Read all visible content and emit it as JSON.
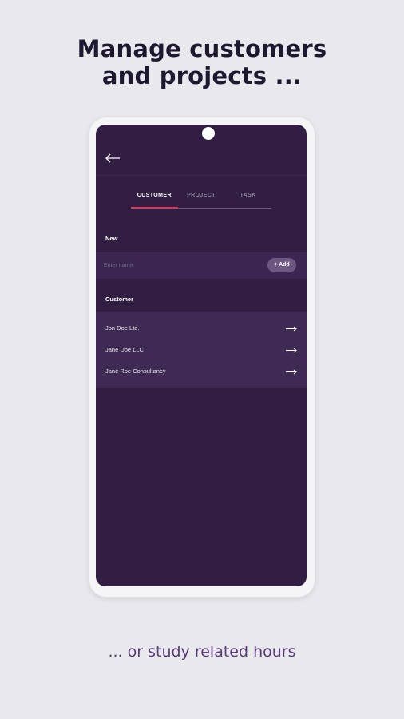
{
  "headline": {
    "line1": "Manage customers",
    "line2": "and projects ..."
  },
  "screen": {
    "tabs": [
      {
        "label": "CUSTOMER",
        "active": true
      },
      {
        "label": "PROJECT",
        "active": false
      },
      {
        "label": "TASK",
        "active": false
      }
    ],
    "new_section": {
      "label": "New",
      "input_value": "",
      "input_placeholder": "Enter name",
      "add_button_label": "+ Add"
    },
    "customer_section": {
      "label": "Customer",
      "items": [
        {
          "name": "Jon Doe Ltd."
        },
        {
          "name": "Jane Doe LLC"
        },
        {
          "name": "Jane Roe Consultancy"
        }
      ]
    }
  },
  "tagline": "... or study related hours",
  "colors": {
    "page_background": "#e9e8ed",
    "screen_background": "#321e42",
    "accent_underline": "#d9365e",
    "add_button": "#6d5884",
    "tagline": "#5b3b7a"
  },
  "icons": {
    "back": "arrow-left-icon",
    "row": "arrow-right-icon",
    "camera": "camera-icon"
  }
}
